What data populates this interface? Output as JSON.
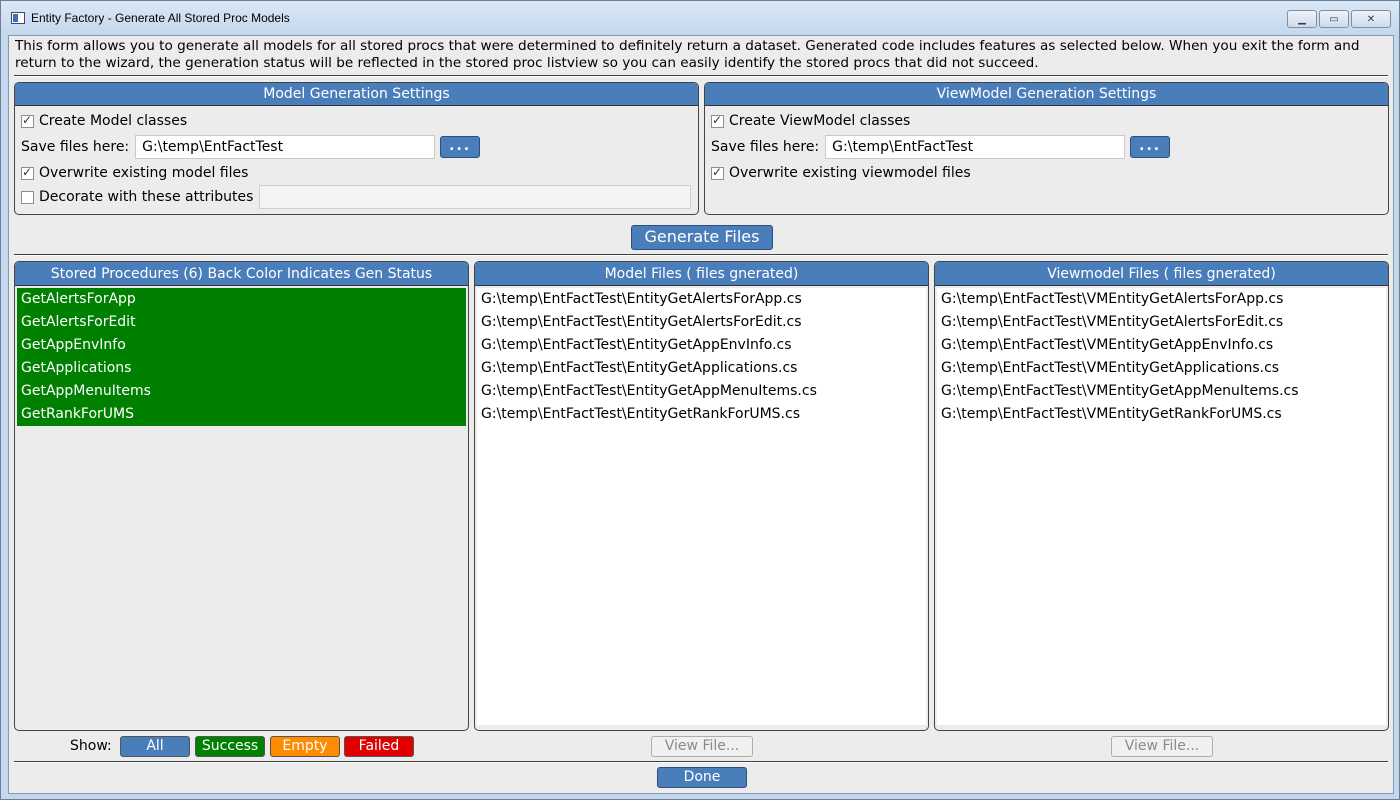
{
  "window": {
    "title": "Entity Factory - Generate All Stored Proc Models",
    "minimize_glyph": "▁",
    "maximize_glyph": "▭",
    "close_glyph": "✕"
  },
  "description": "This form allows you to generate all models for all stored procs that were determined to definitely return a dataset. Generated code includes features as selected below. When you exit the form and return to the wizard, the generation status will be reflected in the stored proc listview so you can easily identify the stored procs that did not succeed.",
  "model_settings": {
    "header": "Model Generation Settings",
    "create_label": "Create Model classes",
    "create_checked": true,
    "save_label": "Save files here:",
    "save_path": "G:\\temp\\EntFactTest",
    "browse_label": "...",
    "overwrite_label": "Overwrite existing model files",
    "overwrite_checked": true,
    "decorate_label": "Decorate with these attributes",
    "decorate_checked": false,
    "decorate_value": ""
  },
  "viewmodel_settings": {
    "header": "ViewModel Generation Settings",
    "create_label": "Create ViewModel classes",
    "create_checked": true,
    "save_label": "Save files here:",
    "save_path": "G:\\temp\\EntFactTest",
    "browse_label": "...",
    "overwrite_label": "Overwrite existing viewmodel files",
    "overwrite_checked": true
  },
  "generate_button": "Generate Files",
  "procs_panel": {
    "header": "Stored Procedures (6) Back Color Indicates Gen Status",
    "items": [
      "GetAlertsForApp",
      "GetAlertsForEdit",
      "GetAppEnvInfo",
      "GetApplications",
      "GetAppMenuItems",
      "GetRankForUMS"
    ],
    "status_color": "#008000"
  },
  "model_files_panel": {
    "header": "Model Files ( files gnerated)",
    "items": [
      "G:\\temp\\EntFactTest\\EntityGetAlertsForApp.cs",
      "G:\\temp\\EntFactTest\\EntityGetAlertsForEdit.cs",
      "G:\\temp\\EntFactTest\\EntityGetAppEnvInfo.cs",
      "G:\\temp\\EntFactTest\\EntityGetApplications.cs",
      "G:\\temp\\EntFactTest\\EntityGetAppMenuItems.cs",
      "G:\\temp\\EntFactTest\\EntityGetRankForUMS.cs"
    ],
    "view_button": "View File..."
  },
  "viewmodel_files_panel": {
    "header": "Viewmodel Files ( files gnerated)",
    "items": [
      "G:\\temp\\EntFactTest\\VMEntityGetAlertsForApp.cs",
      "G:\\temp\\EntFactTest\\VMEntityGetAlertsForEdit.cs",
      "G:\\temp\\EntFactTest\\VMEntityGetAppEnvInfo.cs",
      "G:\\temp\\EntFactTest\\VMEntityGetApplications.cs",
      "G:\\temp\\EntFactTest\\VMEntityGetAppMenuItems.cs",
      "G:\\temp\\EntFactTest\\VMEntityGetRankForUMS.cs"
    ],
    "view_button": "View File..."
  },
  "filter": {
    "show_label": "Show:",
    "buttons": [
      {
        "label": "All",
        "color": "#4a7ebb"
      },
      {
        "label": "Success",
        "color": "#008000"
      },
      {
        "label": "Empty",
        "color": "#ff8c00"
      },
      {
        "label": "Failed",
        "color": "#e00000"
      }
    ]
  },
  "done_button": "Done"
}
